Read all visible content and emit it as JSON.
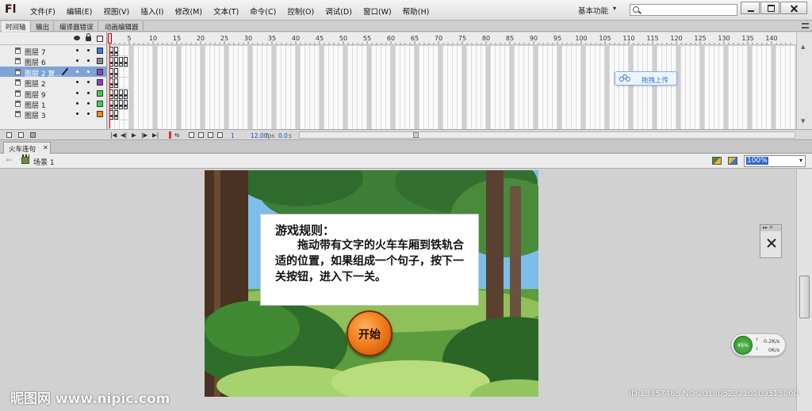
{
  "app": {
    "logo": "Fl",
    "menu": [
      "文件(F)",
      "编辑(E)",
      "视图(V)",
      "插入(I)",
      "修改(M)",
      "文本(T)",
      "命令(C)",
      "控制(O)",
      "调试(D)",
      "窗口(W)",
      "帮助(H)"
    ],
    "workspace": "基本功能",
    "workspace_caret": "▾",
    "search": {
      "value": ""
    }
  },
  "timeline": {
    "tabs": [
      "时间轴",
      "输出",
      "编译器错误",
      "动画编辑器"
    ],
    "ruler_labels": [
      "1",
      "5",
      "10",
      "15",
      "20",
      "25",
      "30",
      "35",
      "40",
      "45",
      "50",
      "55",
      "60",
      "65",
      "70",
      "75",
      "80",
      "85",
      "90",
      "95",
      "100",
      "105",
      "110",
      "115",
      "120",
      "125",
      "130",
      "135",
      "140"
    ],
    "layers": [
      {
        "name": "图层 7",
        "color": "#3a78e8",
        "selected": false,
        "editing": false
      },
      {
        "name": "图层 6",
        "color": "#8c8c8c",
        "selected": false,
        "editing": false
      },
      {
        "name": "图层 2 复...",
        "color": "#8e3fc0",
        "selected": true,
        "editing": true
      },
      {
        "name": "图层 2",
        "color": "#8e3fc0",
        "selected": false,
        "editing": false
      },
      {
        "name": "图层 9",
        "color": "#3bd24e",
        "selected": false,
        "editing": false
      },
      {
        "name": "图层 1",
        "color": "#3bd24e",
        "selected": false,
        "editing": false
      },
      {
        "name": "图层 3",
        "color": "#f08a1e",
        "selected": false,
        "editing": false
      }
    ],
    "current_frame": "1",
    "fps": "12.00",
    "fps_unit": "fps",
    "time": "0.0",
    "time_unit": "s"
  },
  "upload_widget": {
    "label": "拖拽上传"
  },
  "document": {
    "tab_label": "火车连句",
    "tab_close": "✕",
    "scene_label": "场景 1",
    "zoom": "100%",
    "zoom_caret": "▾"
  },
  "stage": {
    "rules_title": "游戏规则：",
    "rules_body": "拖动带有文字的火车车厢到铁轨合适的位置，如果组成一个句子，按下一关按钮，进入下一关。",
    "start_label": "开始"
  },
  "tool_panel": {
    "header": "▸▸   ✕"
  },
  "network_widget": {
    "percent": "45%",
    "upload_arrow": "↑",
    "download_arrow": "↓",
    "upload_speed": "0.2K/s",
    "download_speed": "0K/s"
  },
  "watermarks": {
    "site": "昵图网 www.nipic.com",
    "id": "ID:13357488 NO:20180523210109515000"
  },
  "colors": {
    "selection": "#7ea3d6",
    "playhead": "#dd0000",
    "readout": "#1c57b5",
    "start_button": "#f07a1a"
  }
}
